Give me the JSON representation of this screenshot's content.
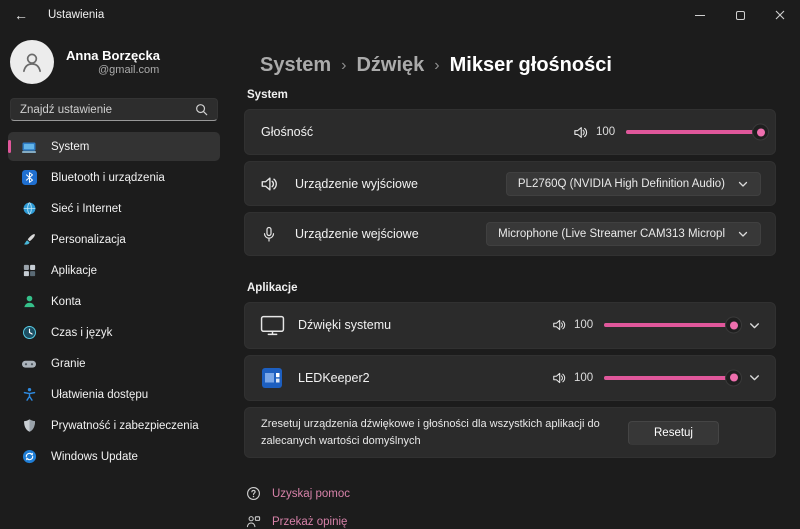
{
  "colors": {
    "accent": "#e0579b",
    "link": "#d782a9",
    "card_bg": "#2b2b2b",
    "window_bg": "#1c1c1c"
  },
  "icons": {
    "back": "arrow-left",
    "minimize": "horizontal-bar",
    "maximize": "square",
    "close": "x",
    "search": "magnifier",
    "volume": "speaker-waves",
    "microphone": "mic",
    "monitor": "monitor",
    "chevron_down": "chevron-down",
    "help": "question-circle",
    "feedback": "person-chat"
  },
  "titlebar": {
    "title": "Ustawienia",
    "back_glyph": "←"
  },
  "sidebar": {
    "user": {
      "name": "Anna Borzęcka",
      "email": "@gmail.com"
    },
    "search_placeholder": "Znajdź ustawienie",
    "items": [
      {
        "label": "System",
        "icon": "system",
        "selected": true
      },
      {
        "label": "Bluetooth i urządzenia",
        "icon": "bluetooth",
        "selected": false
      },
      {
        "label": "Sieć i Internet",
        "icon": "network",
        "selected": false
      },
      {
        "label": "Personalizacja",
        "icon": "personalization",
        "selected": false
      },
      {
        "label": "Aplikacje",
        "icon": "apps",
        "selected": false
      },
      {
        "label": "Konta",
        "icon": "accounts",
        "selected": false
      },
      {
        "label": "Czas i język",
        "icon": "time-language",
        "selected": false
      },
      {
        "label": "Granie",
        "icon": "gaming",
        "selected": false
      },
      {
        "label": "Ułatwienia dostępu",
        "icon": "accessibility",
        "selected": false
      },
      {
        "label": "Prywatność i zabezpieczenia",
        "icon": "privacy",
        "selected": false
      },
      {
        "label": "Windows Update",
        "icon": "windows-update",
        "selected": false
      }
    ]
  },
  "main": {
    "breadcrumb": {
      "items": [
        "System",
        "Dźwięk",
        "Mikser głośności"
      ],
      "separator": "›"
    },
    "system_section": {
      "label": "System",
      "volume_row": {
        "label": "Głośność",
        "value": 100
      },
      "output_row": {
        "label": "Urządzenie wyjściowe",
        "selected": "PL2760Q (NVIDIA High Definition Audio)"
      },
      "input_row": {
        "label": "Urządzenie wejściowe",
        "selected": "Microphone (Live Streamer CAM313 Micropl"
      }
    },
    "apps_section": {
      "label": "Aplikacje",
      "rows": [
        {
          "label": "Dźwięki systemu",
          "value": 100
        },
        {
          "label": "LEDKeeper2",
          "value": 100
        }
      ],
      "reset_row": {
        "text": "Zresetuj urządzenia dźwiękowe i głośności dla wszystkich aplikacji do zalecanych wartości domyślnych",
        "button": "Resetuj"
      }
    },
    "footer_links": [
      {
        "label": "Uzyskaj pomoc"
      },
      {
        "label": "Przekaż opinię"
      }
    ]
  }
}
